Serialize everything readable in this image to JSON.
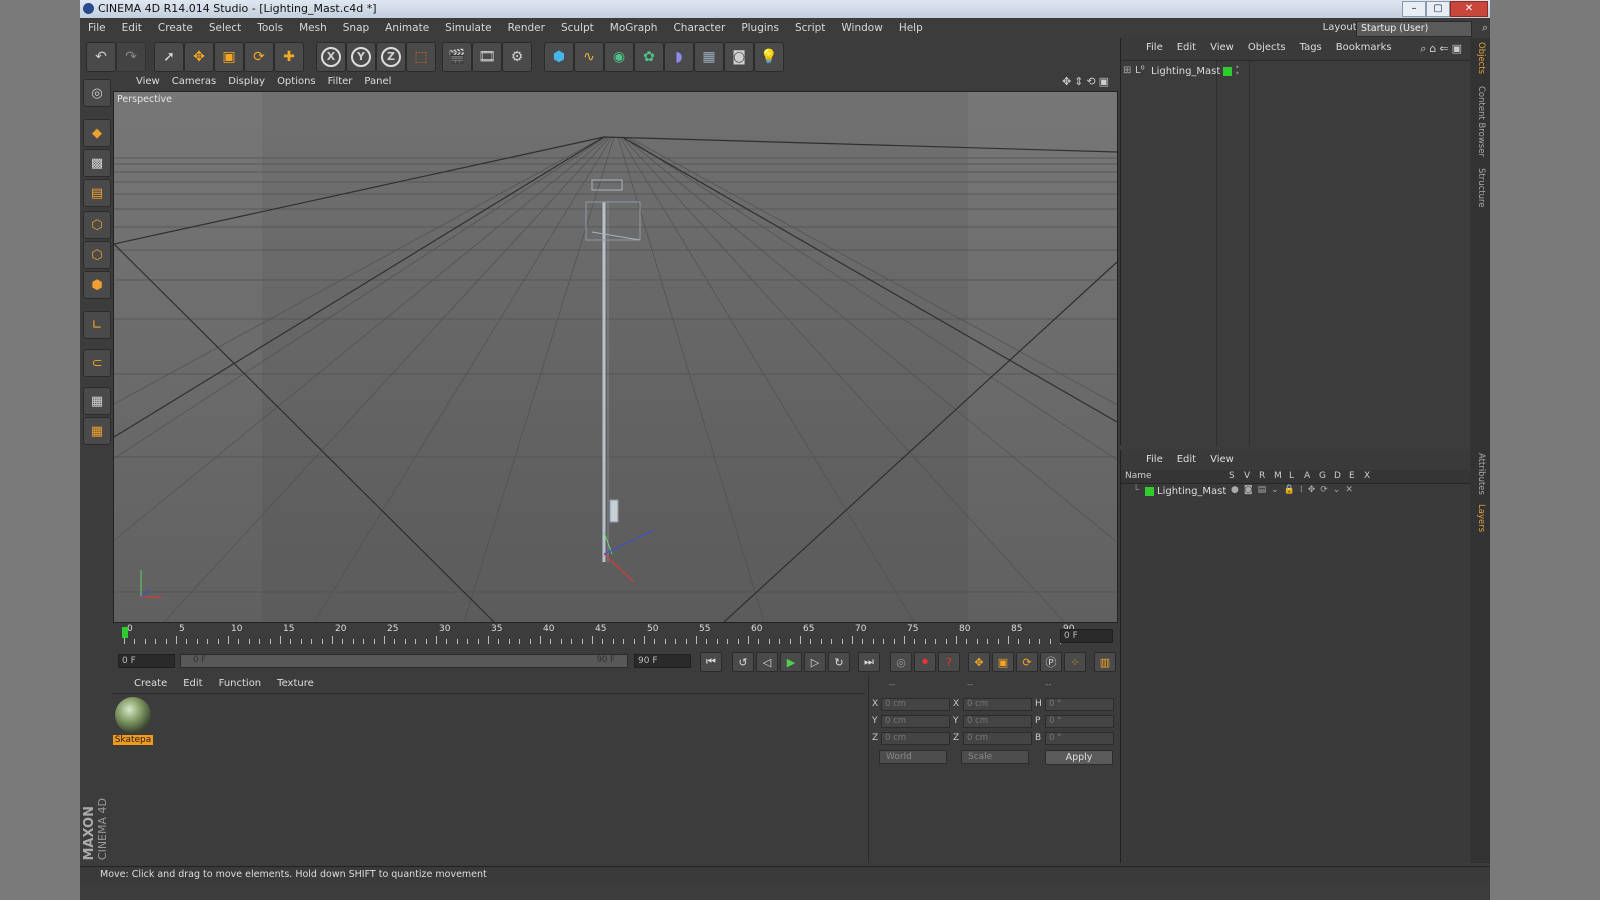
{
  "window": {
    "title": "CINEMA 4D R14.014 Studio - [Lighting_Mast.c4d *]",
    "controls": [
      "–",
      "▢",
      "✕"
    ]
  },
  "menubar": {
    "items": [
      "File",
      "Edit",
      "Create",
      "Select",
      "Tools",
      "Mesh",
      "Snap",
      "Animate",
      "Simulate",
      "Render",
      "Sculpt",
      "MoGraph",
      "Character",
      "Plugins",
      "Script",
      "Window",
      "Help"
    ],
    "layout_label": "Layout:",
    "layout_value": "Startup (User)"
  },
  "toolbar": {
    "icons": [
      "undo-icon",
      "redo-icon",
      "live-selection-icon",
      "move-icon",
      "scale-icon",
      "rotate-icon",
      "add-icon",
      "x-axis-icon",
      "y-axis-icon",
      "z-axis-icon",
      "coordinate-system-icon",
      "render-view-icon",
      "render-picture-viewer-icon",
      "edit-render-settings-icon",
      "cube-icon",
      "spline-icon",
      "nurbs-icon",
      "array-icon",
      "deformer-icon",
      "floor-icon",
      "camera-icon",
      "light-icon"
    ],
    "axis_labels": [
      "X",
      "Y",
      "Z"
    ]
  },
  "left_toolbar": {
    "icons": [
      "make-editable-icon",
      "model-mode-icon",
      "texture-mode-icon",
      "workplane-mode-icon",
      "points-mode-icon",
      "edges-mode-icon",
      "polygons-mode-icon",
      "axis-mode-icon",
      "snap-icon",
      "workplane-icon",
      "locked-workplane-icon"
    ]
  },
  "viewport": {
    "menu": [
      "View",
      "Cameras",
      "Display",
      "Options",
      "Filter",
      "Panel"
    ],
    "label": "Perspective"
  },
  "timeline": {
    "ticks": [
      "0",
      "5",
      "10",
      "15",
      "20",
      "25",
      "30",
      "35",
      "40",
      "45",
      "50",
      "55",
      "60",
      "65",
      "70",
      "75",
      "80",
      "85",
      "90"
    ],
    "current_frame": "0 F",
    "start_field": "0 F",
    "range_start": "0 F",
    "range_end": "90 F",
    "end_field": "90 F"
  },
  "material_manager": {
    "menu": [
      "Create",
      "Edit",
      "Function",
      "Texture"
    ],
    "materials": [
      {
        "name": "Skatepa"
      }
    ]
  },
  "coordinates": {
    "header": [
      "--",
      "--",
      "--"
    ],
    "rows": [
      {
        "l1": "X",
        "v1": "0 cm",
        "l2": "X",
        "v2": "0 cm",
        "l3": "H",
        "v3": "0 °"
      },
      {
        "l1": "Y",
        "v1": "0 cm",
        "l2": "Y",
        "v2": "0 cm",
        "l3": "P",
        "v3": "0 °"
      },
      {
        "l1": "Z",
        "v1": "0 cm",
        "l2": "Z",
        "v2": "0 cm",
        "l3": "B",
        "v3": "0 °"
      }
    ],
    "mode": "World",
    "transform": "Scale",
    "apply": "Apply"
  },
  "object_manager": {
    "menu": [
      "File",
      "Edit",
      "View",
      "Objects",
      "Tags",
      "Bookmarks"
    ],
    "objects": [
      {
        "name": "Lighting_Mast",
        "color": "#2fcc2f"
      }
    ]
  },
  "layer_manager": {
    "menu": [
      "File",
      "Edit",
      "View"
    ],
    "columns": [
      "Name",
      "S",
      "V",
      "R",
      "M",
      "L",
      "A",
      "G",
      "D",
      "E",
      "X"
    ],
    "layers": [
      {
        "name": "Lighting_Mast",
        "color": "#2fcc2f"
      }
    ]
  },
  "right_tabs": [
    "Objects",
    "Content Browser",
    "Structure",
    "Attributes",
    "Layers"
  ],
  "status": {
    "text": "Move: Click and drag to move elements. Hold down SHIFT to quantize movement"
  },
  "brand": {
    "line1": "MAXON",
    "line2": "CINEMA 4D"
  }
}
